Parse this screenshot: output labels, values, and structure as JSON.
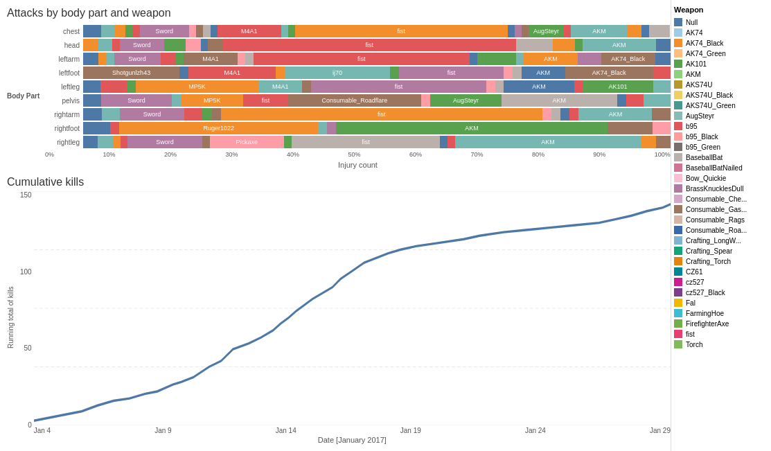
{
  "top_chart": {
    "title": "Attacks by body part and weapon",
    "body_part_label": "Body Part",
    "x_axis_label": "Injury count",
    "x_ticks": [
      "0%",
      "10%",
      "20%",
      "30%",
      "40%",
      "50%",
      "60%",
      "70%",
      "80%",
      "90%",
      "100%"
    ],
    "rows": [
      {
        "label": "chest",
        "segments": [
          {
            "color": "#4e79a7",
            "width": 2.5,
            "text": ""
          },
          {
            "color": "#76b7b2",
            "width": 2,
            "text": ""
          },
          {
            "color": "#f28e2b",
            "width": 1.5,
            "text": ""
          },
          {
            "color": "#59a14f",
            "width": 1,
            "text": ""
          },
          {
            "color": "#e15759",
            "width": 1,
            "text": ""
          },
          {
            "color": "#b07aa1",
            "width": 7,
            "text": "Sword"
          },
          {
            "color": "#ff9da7",
            "width": 1,
            "text": ""
          },
          {
            "color": "#9c755f",
            "width": 1,
            "text": ""
          },
          {
            "color": "#bab0ac",
            "width": 1,
            "text": ""
          },
          {
            "color": "#4e79a7",
            "width": 1,
            "text": ""
          },
          {
            "color": "#e15759",
            "width": 9,
            "text": "M4A1"
          },
          {
            "color": "#76b7b2",
            "width": 1,
            "text": ""
          },
          {
            "color": "#59a14f",
            "width": 1,
            "text": ""
          },
          {
            "color": "#f28e2b",
            "width": 30,
            "text": "fist"
          },
          {
            "color": "#4e79a7",
            "width": 1,
            "text": ""
          },
          {
            "color": "#b07aa1",
            "width": 1,
            "text": ""
          },
          {
            "color": "#9c755f",
            "width": 1,
            "text": ""
          },
          {
            "color": "#59a14f",
            "width": 5,
            "text": "AugSteyr"
          },
          {
            "color": "#e15759",
            "width": 1,
            "text": ""
          },
          {
            "color": "#76b7b2",
            "width": 8,
            "text": "AKM"
          },
          {
            "color": "#f28e2b",
            "width": 2,
            "text": ""
          },
          {
            "color": "#4e79a7",
            "width": 1,
            "text": ""
          },
          {
            "color": "#bab0ac",
            "width": 3,
            "text": ""
          }
        ]
      },
      {
        "label": "head",
        "segments": [
          {
            "color": "#f28e2b",
            "width": 2,
            "text": ""
          },
          {
            "color": "#76b7b2",
            "width": 2,
            "text": ""
          },
          {
            "color": "#e15759",
            "width": 1,
            "text": ""
          },
          {
            "color": "#b07aa1",
            "width": 6,
            "text": "Sword"
          },
          {
            "color": "#59a14f",
            "width": 3,
            "text": ""
          },
          {
            "color": "#ff9da7",
            "width": 2,
            "text": ""
          },
          {
            "color": "#4e79a7",
            "width": 1,
            "text": ""
          },
          {
            "color": "#9c755f",
            "width": 2,
            "text": ""
          },
          {
            "color": "#e15759",
            "width": 40,
            "text": "fist"
          },
          {
            "color": "#bab0ac",
            "width": 5,
            "text": ""
          },
          {
            "color": "#f28e2b",
            "width": 3,
            "text": ""
          },
          {
            "color": "#59a14f",
            "width": 1,
            "text": ""
          },
          {
            "color": "#76b7b2",
            "width": 10,
            "text": "AKM"
          },
          {
            "color": "#4e79a7",
            "width": 2,
            "text": ""
          }
        ]
      },
      {
        "label": "leftarm",
        "segments": [
          {
            "color": "#4e79a7",
            "width": 2,
            "text": ""
          },
          {
            "color": "#f28e2b",
            "width": 1,
            "text": ""
          },
          {
            "color": "#76b7b2",
            "width": 1,
            "text": ""
          },
          {
            "color": "#b07aa1",
            "width": 6,
            "text": "Sword"
          },
          {
            "color": "#e15759",
            "width": 2,
            "text": ""
          },
          {
            "color": "#59a14f",
            "width": 1,
            "text": ""
          },
          {
            "color": "#9c755f",
            "width": 7,
            "text": "M4A1"
          },
          {
            "color": "#ff9da7",
            "width": 1,
            "text": ""
          },
          {
            "color": "#bab0ac",
            "width": 1,
            "text": ""
          },
          {
            "color": "#e15759",
            "width": 28,
            "text": "fist"
          },
          {
            "color": "#4e79a7",
            "width": 1,
            "text": ""
          },
          {
            "color": "#59a14f",
            "width": 5,
            "text": ""
          },
          {
            "color": "#76b7b2",
            "width": 1,
            "text": ""
          },
          {
            "color": "#f28e2b",
            "width": 7,
            "text": "AKM"
          },
          {
            "color": "#b07aa1",
            "width": 3,
            "text": ""
          },
          {
            "color": "#9c755f",
            "width": 7,
            "text": "AK74_Black"
          },
          {
            "color": "#4e79a7",
            "width": 2,
            "text": ""
          }
        ]
      },
      {
        "label": "leftfoot",
        "segments": [
          {
            "color": "#9c755f",
            "width": 11,
            "text": "Shotgunlzh43"
          },
          {
            "color": "#4e79a7",
            "width": 1,
            "text": ""
          },
          {
            "color": "#e15759",
            "width": 10,
            "text": "M4A1"
          },
          {
            "color": "#f28e2b",
            "width": 1,
            "text": ""
          },
          {
            "color": "#76b7b2",
            "width": 12,
            "text": "ij70"
          },
          {
            "color": "#59a14f",
            "width": 1,
            "text": ""
          },
          {
            "color": "#b07aa1",
            "width": 12,
            "text": "fist"
          },
          {
            "color": "#ff9da7",
            "width": 1,
            "text": ""
          },
          {
            "color": "#bab0ac",
            "width": 1,
            "text": ""
          },
          {
            "color": "#4e79a7",
            "width": 5,
            "text": "AKM"
          },
          {
            "color": "#9c755f",
            "width": 10,
            "text": "AK74_Black"
          },
          {
            "color": "#e15759",
            "width": 2,
            "text": ""
          }
        ]
      },
      {
        "label": "leftleg",
        "segments": [
          {
            "color": "#4e79a7",
            "width": 2,
            "text": ""
          },
          {
            "color": "#e15759",
            "width": 3,
            "text": ""
          },
          {
            "color": "#59a14f",
            "width": 1,
            "text": ""
          },
          {
            "color": "#f28e2b",
            "width": 14,
            "text": "MP5K"
          },
          {
            "color": "#76b7b2",
            "width": 5,
            "text": "M4A1"
          },
          {
            "color": "#9c755f",
            "width": 1,
            "text": ""
          },
          {
            "color": "#b07aa1",
            "width": 20,
            "text": "fist"
          },
          {
            "color": "#ff9da7",
            "width": 1,
            "text": ""
          },
          {
            "color": "#bab0ac",
            "width": 1,
            "text": ""
          },
          {
            "color": "#4e79a7",
            "width": 8,
            "text": "AKM"
          },
          {
            "color": "#e15759",
            "width": 1,
            "text": ""
          },
          {
            "color": "#59a14f",
            "width": 8,
            "text": "AK101"
          },
          {
            "color": "#76b7b2",
            "width": 2,
            "text": ""
          }
        ]
      },
      {
        "label": "pelvis",
        "segments": [
          {
            "color": "#4e79a7",
            "width": 2,
            "text": ""
          },
          {
            "color": "#b07aa1",
            "width": 8,
            "text": "Sword"
          },
          {
            "color": "#76b7b2",
            "width": 1,
            "text": ""
          },
          {
            "color": "#f28e2b",
            "width": 7,
            "text": "MP5K"
          },
          {
            "color": "#e15759",
            "width": 5,
            "text": "fist"
          },
          {
            "color": "#9c755f",
            "width": 15,
            "text": "Consumable_Roadflare"
          },
          {
            "color": "#ff9da7",
            "width": 1,
            "text": ""
          },
          {
            "color": "#59a14f",
            "width": 8,
            "text": "AugSteyr"
          },
          {
            "color": "#bab0ac",
            "width": 13,
            "text": "AKM"
          },
          {
            "color": "#4e79a7",
            "width": 1,
            "text": ""
          },
          {
            "color": "#e15759",
            "width": 2,
            "text": ""
          },
          {
            "color": "#76b7b2",
            "width": 3,
            "text": ""
          }
        ]
      },
      {
        "label": "rightarm",
        "segments": [
          {
            "color": "#4e79a7",
            "width": 2,
            "text": ""
          },
          {
            "color": "#76b7b2",
            "width": 2,
            "text": ""
          },
          {
            "color": "#b07aa1",
            "width": 7,
            "text": "Sword"
          },
          {
            "color": "#e15759",
            "width": 2,
            "text": ""
          },
          {
            "color": "#59a14f",
            "width": 1,
            "text": ""
          },
          {
            "color": "#9c755f",
            "width": 1,
            "text": ""
          },
          {
            "color": "#f28e2b",
            "width": 35,
            "text": "fist"
          },
          {
            "color": "#ff9da7",
            "width": 1,
            "text": ""
          },
          {
            "color": "#bab0ac",
            "width": 1,
            "text": ""
          },
          {
            "color": "#4e79a7",
            "width": 1,
            "text": ""
          },
          {
            "color": "#e15759",
            "width": 1,
            "text": ""
          },
          {
            "color": "#76b7b2",
            "width": 8,
            "text": "AKM"
          },
          {
            "color": "#9c755f",
            "width": 2,
            "text": ""
          }
        ]
      },
      {
        "label": "rightfoot",
        "segments": [
          {
            "color": "#4e79a7",
            "width": 3,
            "text": ""
          },
          {
            "color": "#e15759",
            "width": 1,
            "text": ""
          },
          {
            "color": "#f28e2b",
            "width": 22,
            "text": "Ruger1022"
          },
          {
            "color": "#76b7b2",
            "width": 1,
            "text": ""
          },
          {
            "color": "#b07aa1",
            "width": 1,
            "text": ""
          },
          {
            "color": "#59a14f",
            "width": 30,
            "text": "AKM"
          },
          {
            "color": "#9c755f",
            "width": 5,
            "text": ""
          },
          {
            "color": "#ff9da7",
            "width": 2,
            "text": ""
          }
        ]
      },
      {
        "label": "rightleg",
        "segments": [
          {
            "color": "#4e79a7",
            "width": 2,
            "text": ""
          },
          {
            "color": "#76b7b2",
            "width": 2,
            "text": ""
          },
          {
            "color": "#f28e2b",
            "width": 1,
            "text": ""
          },
          {
            "color": "#e15759",
            "width": 1,
            "text": ""
          },
          {
            "color": "#b07aa1",
            "width": 10,
            "text": "Sword"
          },
          {
            "color": "#9c755f",
            "width": 1,
            "text": ""
          },
          {
            "color": "#ff9da7",
            "width": 10,
            "text": "Pickaxe"
          },
          {
            "color": "#59a14f",
            "width": 1,
            "text": ""
          },
          {
            "color": "#bab0ac",
            "width": 20,
            "text": "fist"
          },
          {
            "color": "#4e79a7",
            "width": 1,
            "text": ""
          },
          {
            "color": "#e15759",
            "width": 1,
            "text": ""
          },
          {
            "color": "#76b7b2",
            "width": 25,
            "text": "AKM"
          },
          {
            "color": "#f28e2b",
            "width": 2,
            "text": ""
          },
          {
            "color": "#9c755f",
            "width": 2,
            "text": ""
          }
        ]
      }
    ]
  },
  "bottom_chart": {
    "title": "Cumulative kills",
    "y_axis_title": "Running total of kills",
    "x_axis_label": "Date [January 2017]",
    "y_ticks": [
      "0",
      "50",
      "100",
      "150"
    ],
    "x_ticks": [
      "Jan 4",
      "Jan 9",
      "Jan 14",
      "Jan 19",
      "Jan 24",
      "Jan 29"
    ],
    "line_color": "#4e79a7"
  },
  "sidebar": {
    "title": "Weapon",
    "items": [
      {
        "label": "Null",
        "color": "#4e79a7"
      },
      {
        "label": "AK74",
        "color": "#a0cbe8"
      },
      {
        "label": "AK74_Black",
        "color": "#f28e2b"
      },
      {
        "label": "AK74_Green",
        "color": "#ffbe7d"
      },
      {
        "label": "AK101",
        "color": "#59a14f"
      },
      {
        "label": "AKM",
        "color": "#8cd17d"
      },
      {
        "label": "AKS74U",
        "color": "#b6992d"
      },
      {
        "label": "AKS74U_Black",
        "color": "#f1ce63"
      },
      {
        "label": "AKS74U_Green",
        "color": "#499894"
      },
      {
        "label": "AugSteyr",
        "color": "#86bcb6"
      },
      {
        "label": "b95",
        "color": "#e15759"
      },
      {
        "label": "b95_Black",
        "color": "#ff9d9a"
      },
      {
        "label": "b95_Green",
        "color": "#79706e"
      },
      {
        "label": "BaseballBat",
        "color": "#bab0ac"
      },
      {
        "label": "BaseballBatNailed",
        "color": "#d37295"
      },
      {
        "label": "Bow_Quickie",
        "color": "#fabfd2"
      },
      {
        "label": "BrassKnucklesDull",
        "color": "#b07aa1"
      },
      {
        "label": "Consumable_Che...",
        "color": "#d4a6c8"
      },
      {
        "label": "Consumable_Gas...",
        "color": "#9d7660"
      },
      {
        "label": "Consumable_Rags",
        "color": "#d7b5a6"
      },
      {
        "label": "Consumable_Roa...",
        "color": "#3969ac"
      },
      {
        "label": "Crafting_LongW...",
        "color": "#7fb3d3"
      },
      {
        "label": "Crafting_Spear",
        "color": "#11a579"
      },
      {
        "label": "Crafting_Torch",
        "color": "#e68310"
      },
      {
        "label": "CZ61",
        "color": "#008695"
      },
      {
        "label": "cz527",
        "color": "#cf1c90"
      },
      {
        "label": "cz527_Black",
        "color": "#7f3c8d"
      },
      {
        "label": "Fal",
        "color": "#f2b701"
      },
      {
        "label": "FarmingHoe",
        "color": "#3ebcd2"
      },
      {
        "label": "FirefighterAxe",
        "color": "#73af48"
      },
      {
        "label": "fist",
        "color": "#e73f74"
      },
      {
        "label": "Torch",
        "color": "#80ba5a"
      }
    ]
  }
}
